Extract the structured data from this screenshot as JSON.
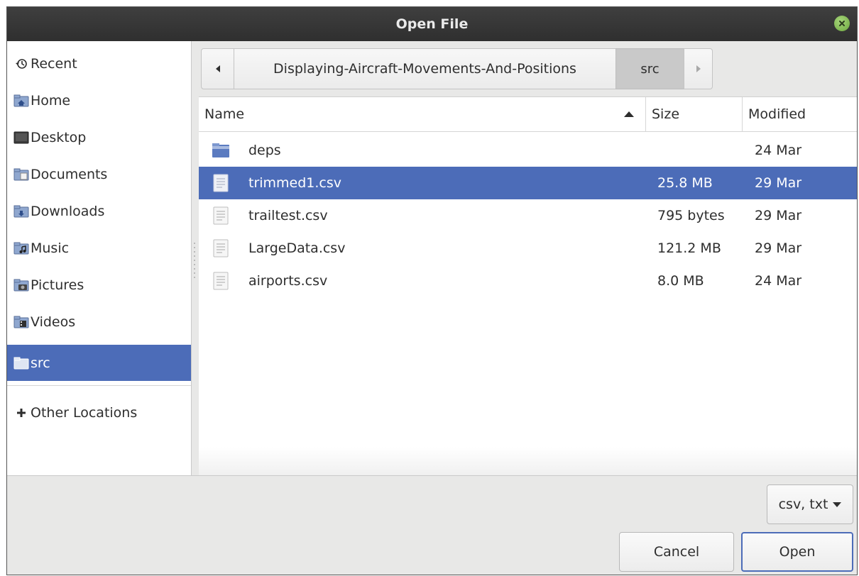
{
  "window": {
    "title": "Open File"
  },
  "sidebar": {
    "items": [
      {
        "label": "Recent",
        "icon": "recent-icon"
      },
      {
        "label": "Home",
        "icon": "home-folder-icon"
      },
      {
        "label": "Desktop",
        "icon": "desktop-icon"
      },
      {
        "label": "Documents",
        "icon": "documents-folder-icon"
      },
      {
        "label": "Downloads",
        "icon": "downloads-folder-icon"
      },
      {
        "label": "Music",
        "icon": "music-folder-icon"
      },
      {
        "label": "Pictures",
        "icon": "pictures-folder-icon"
      },
      {
        "label": "Videos",
        "icon": "videos-folder-icon"
      },
      {
        "label": "src",
        "icon": "folder-icon",
        "selected": true
      }
    ],
    "other_locations": {
      "label": "Other Locations",
      "icon": "plus-icon"
    }
  },
  "pathbar": {
    "segments": [
      "Displaying-Aircraft-Movements-And-Positions",
      "src"
    ],
    "back_icon": "left-arrow-icon",
    "forward_icon": "right-arrow-icon"
  },
  "columns": {
    "name": "Name",
    "size": "Size",
    "modified": "Modified"
  },
  "files": [
    {
      "name": "deps",
      "size": "",
      "modified": "24 Mar",
      "type": "folder"
    },
    {
      "name": "trimmed1.csv",
      "size": "25.8 MB",
      "modified": "29 Mar",
      "type": "text",
      "selected": true
    },
    {
      "name": "trailtest.csv",
      "size": "795 bytes",
      "modified": "29 Mar",
      "type": "text"
    },
    {
      "name": "LargeData.csv",
      "size": "121.2 MB",
      "modified": "29 Mar",
      "type": "text"
    },
    {
      "name": "airports.csv",
      "size": "8.0 MB",
      "modified": "24 Mar",
      "type": "text"
    }
  ],
  "filter": {
    "label": "csv, txt"
  },
  "buttons": {
    "cancel": "Cancel",
    "open": "Open"
  },
  "colors": {
    "selection": "#4c6cb8",
    "titlebar": "#333333",
    "close": "#8cc660"
  }
}
